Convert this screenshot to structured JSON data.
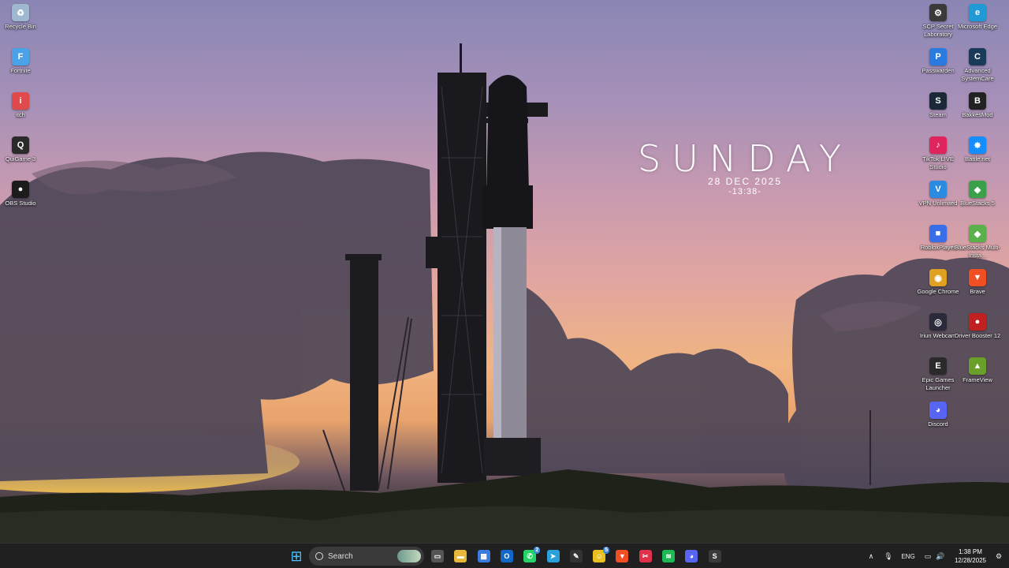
{
  "desktop": {
    "left_icons": [
      {
        "label": "Recycle Bin",
        "icon": "recycle-bin-icon",
        "color": "#9fb8d0",
        "glyph": "♻"
      },
      {
        "label": "Fortnite",
        "icon": "fortnite-icon",
        "color": "#4aa3e8",
        "glyph": "F"
      },
      {
        "label": "itch",
        "icon": "itch-icon",
        "color": "#e04a4a",
        "glyph": "i"
      },
      {
        "label": "QuiGame 3",
        "icon": "game-icon",
        "color": "#2a2a2a",
        "glyph": "Q"
      },
      {
        "label": "OBS Studio",
        "icon": "obs-icon",
        "color": "#1c1c1c",
        "glyph": "●"
      }
    ],
    "right_icons": [
      {
        "label": "SCP Secret Laboratory",
        "icon": "scp-icon",
        "color": "#3a3a3a",
        "glyph": "⚙"
      },
      {
        "label": "Microsoft Edge",
        "icon": "edge-icon",
        "color": "#1f9ad6",
        "glyph": "e"
      },
      {
        "label": "Passwarden",
        "icon": "passwarden-icon",
        "color": "#2a7be0",
        "glyph": "P"
      },
      {
        "label": "Advanced SystemCare",
        "icon": "advanced-systemcare-icon",
        "color": "#1a3a5a",
        "glyph": "C"
      },
      {
        "label": "Steam",
        "icon": "steam-icon",
        "color": "#1b2838",
        "glyph": "S"
      },
      {
        "label": "BakkesMod",
        "icon": "bakkesmod-icon",
        "color": "#222222",
        "glyph": "B"
      },
      {
        "label": "TikTok LIVE Studio",
        "icon": "tiktok-icon",
        "color": "#e0245e",
        "glyph": "♪"
      },
      {
        "label": "Battle.net",
        "icon": "battlenet-icon",
        "color": "#148eff",
        "glyph": "✸"
      },
      {
        "label": "VPN Unlimited",
        "icon": "vpn-icon",
        "color": "#2a8be0",
        "glyph": "V"
      },
      {
        "label": "BlueStacks 5",
        "icon": "bluestacks-icon",
        "color": "#3aa04a",
        "glyph": "◆"
      },
      {
        "label": "RobloxPlayer",
        "icon": "roblox-icon",
        "color": "#3a6de8",
        "glyph": "■"
      },
      {
        "label": "BlueStacks Multi-Insta...",
        "icon": "bluestacks-multi-icon",
        "color": "#5ab04a",
        "glyph": "◆"
      },
      {
        "label": "Google Chrome",
        "icon": "chrome-icon",
        "color": "#e0a020",
        "glyph": "◉"
      },
      {
        "label": "Brave",
        "icon": "brave-icon",
        "color": "#f04e23",
        "glyph": "▼"
      },
      {
        "label": "Iriun Webcam",
        "icon": "webcam-icon",
        "color": "#2a2a3a",
        "glyph": "◎"
      },
      {
        "label": "Driver Booster 12",
        "icon": "driver-booster-icon",
        "color": "#c02020",
        "glyph": "●"
      },
      {
        "label": "Epic Games Launcher",
        "icon": "epic-games-icon",
        "color": "#2a2a2a",
        "glyph": "E"
      },
      {
        "label": "FrameView",
        "icon": "frameview-icon",
        "color": "#6aa02a",
        "glyph": "▲"
      },
      {
        "label": "Discord",
        "icon": "discord-icon",
        "color": "#5865f2",
        "glyph": "◕"
      }
    ]
  },
  "widget": {
    "day": "SUNDAY",
    "date": "28 DEC 2025",
    "time": "-13:38-"
  },
  "taskbar": {
    "start_glyph": "⊞",
    "search_label": "Search",
    "apps": [
      {
        "name": "task-view",
        "icon": "task-view-icon",
        "color": "#555555",
        "glyph": "▭"
      },
      {
        "name": "file-explorer",
        "icon": "file-explorer-icon",
        "color": "#e8b83a",
        "glyph": "▬"
      },
      {
        "name": "microsoft-store",
        "icon": "store-icon",
        "color": "#3a7be0",
        "glyph": "▦"
      },
      {
        "name": "outlook",
        "icon": "outlook-icon",
        "color": "#1068c8",
        "glyph": "O"
      },
      {
        "name": "whatsapp",
        "icon": "whatsapp-icon",
        "color": "#25d366",
        "glyph": "✆",
        "badge": "2"
      },
      {
        "name": "telegram",
        "icon": "telegram-icon",
        "color": "#2aa1da",
        "glyph": "➤"
      },
      {
        "name": "notepad",
        "icon": "notepad-icon",
        "color": "#333333",
        "glyph": "✎"
      },
      {
        "name": "emoji-app",
        "icon": "smile-icon",
        "color": "#e8c020",
        "glyph": "☺",
        "badge": "5"
      },
      {
        "name": "brave",
        "icon": "brave-icon",
        "color": "#f04e23",
        "glyph": "▼"
      },
      {
        "name": "snipping",
        "icon": "snip-icon",
        "color": "#e0304a",
        "glyph": "✂"
      },
      {
        "name": "spotify",
        "icon": "spotify-icon",
        "color": "#1db954",
        "glyph": "≋"
      },
      {
        "name": "discord",
        "icon": "discord-icon",
        "color": "#5865f2",
        "glyph": "◕"
      },
      {
        "name": "steam",
        "icon": "steam-icon",
        "color": "#3a3a3a",
        "glyph": "S"
      }
    ],
    "tray": {
      "chevron": "∧",
      "mic": "🎙",
      "lang": "ENG",
      "net": "▭",
      "volume": "🔊",
      "time": "1:38 PM",
      "date": "12/28/2025",
      "notif": "⚙"
    }
  }
}
